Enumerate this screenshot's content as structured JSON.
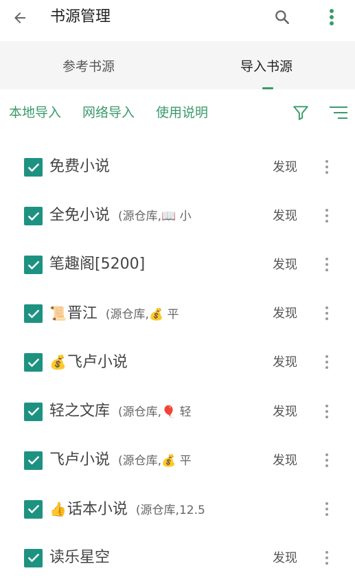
{
  "appbar": {
    "title": "书源管理",
    "back_icon": "arrow-left-icon",
    "search_icon": "search-icon",
    "more_icon": "more-vertical-icon",
    "accent_color": "#3a9a6a"
  },
  "tabs": [
    {
      "label": "参考书源",
      "selected": false
    },
    {
      "label": "导入书源",
      "selected": true
    }
  ],
  "actions": {
    "local_import": "本地导入",
    "network_import": "网络导入",
    "usage": "使用说明",
    "filter_icon": "filter-icon",
    "sort_icon": "sort-icon"
  },
  "sources": [
    {
      "emoji": "",
      "name": "免费小说",
      "group": "",
      "find": "发现",
      "checked": true
    },
    {
      "emoji": "",
      "name": "全免小说",
      "group": "(源仓库,📖 小",
      "find": "发现",
      "checked": true
    },
    {
      "emoji": "",
      "name": "笔趣阁[5200]",
      "group": "",
      "find": "发现",
      "checked": true
    },
    {
      "emoji": "📜",
      "name": "晋江",
      "group": "(源仓库,💰 平",
      "find": "发现",
      "checked": true
    },
    {
      "emoji": "💰",
      "name": "飞卢小说",
      "group": "",
      "find": "发现",
      "checked": true
    },
    {
      "emoji": "",
      "name": "轻之文库",
      "group": "(源仓库,🎈 轻",
      "find": "发现",
      "checked": true
    },
    {
      "emoji": "",
      "name": "飞卢小说",
      "group": "(源仓库,💰 平",
      "find": "发现",
      "checked": true
    },
    {
      "emoji": "👍",
      "name": "话本小说",
      "group": "(源仓库,12.5",
      "find": "",
      "checked": true
    },
    {
      "emoji": "",
      "name": "读乐星空",
      "group": "",
      "find": "发现",
      "checked": true
    }
  ],
  "colors": {
    "checkbox": "#1e9281",
    "tab_bg": "#f5f5f5"
  }
}
